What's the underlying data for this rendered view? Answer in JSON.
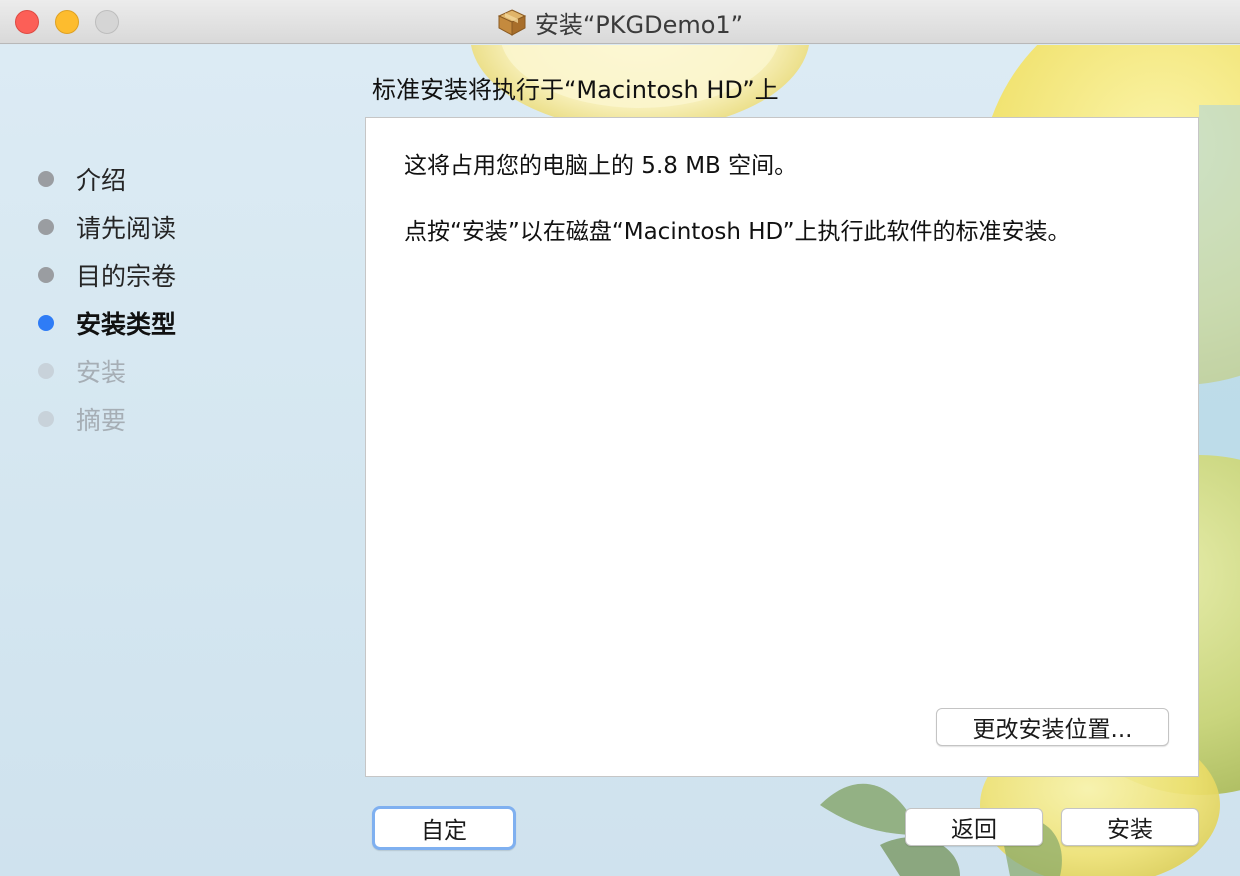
{
  "window": {
    "title": "安装“PKGDemo1”",
    "icon": "package-icon"
  },
  "traffic_lights": {
    "close_color": "#fc5f57",
    "minimize_color": "#fdbc2e",
    "zoom_color": "#d5d5d5"
  },
  "sidebar": {
    "steps": [
      {
        "label": "介绍",
        "state": "done"
      },
      {
        "label": "请先阅读",
        "state": "done"
      },
      {
        "label": "目的宗卷",
        "state": "done"
      },
      {
        "label": "安装类型",
        "state": "current"
      },
      {
        "label": "安装",
        "state": "future"
      },
      {
        "label": "摘要",
        "state": "future"
      }
    ],
    "current_color": "#2f7cf6"
  },
  "main": {
    "heading": "标准安装将执行于“Macintosh HD”上",
    "paragraph1": "这将占用您的电脑上的 5.8 MB 空间。",
    "paragraph2": "点按“安装”以在磁盘“Macintosh HD”上执行此软件的标准安装。",
    "change_location_label": "更改安装位置..."
  },
  "footer": {
    "customize_label": "自定",
    "back_label": "返回",
    "install_label": "安装"
  }
}
